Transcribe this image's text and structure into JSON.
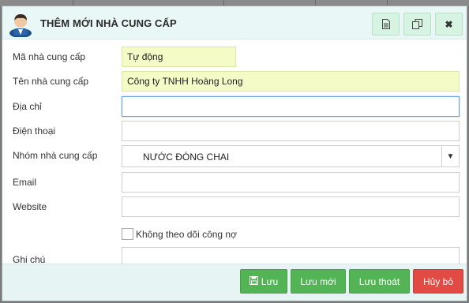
{
  "dialog": {
    "title": "THÊM MỚI NHÀ CUNG CẤP",
    "toolbar": {
      "doc_icon": "document-icon",
      "copy_icon": "copy-icon",
      "close_label": "✖"
    }
  },
  "form": {
    "ma": {
      "label": "Mã nhà cung cấp",
      "value": "Tự động"
    },
    "ten": {
      "label": "Tên nhà cung cấp",
      "value": "Công ty TNHH Hoàng Long"
    },
    "diachi": {
      "label": "Địa chỉ",
      "value": ""
    },
    "dienthoai": {
      "label": "Điện thoại",
      "value": ""
    },
    "nhom": {
      "label": "Nhóm nhà cung cấp",
      "value": "NƯỚC ĐÓNG CHAI",
      "arrow": "▼"
    },
    "email": {
      "label": "Email",
      "value": ""
    },
    "website": {
      "label": "Website",
      "value": ""
    },
    "khongtheodoi": {
      "label": "Không theo dõi công nợ",
      "checked": false
    },
    "ghichu": {
      "label": "Ghi chú",
      "value": ""
    }
  },
  "footer": {
    "luu": "Lưu",
    "luu_moi": "Lưu mới",
    "luu_thoat": "Lưu thoát",
    "huy_bo": "Hủy bỏ"
  },
  "colors": {
    "primary_button": "#52b454",
    "danger_button": "#e24a44",
    "titlebar_bg": "#e9f8f7",
    "input_highlight": "#f4fbc7"
  }
}
